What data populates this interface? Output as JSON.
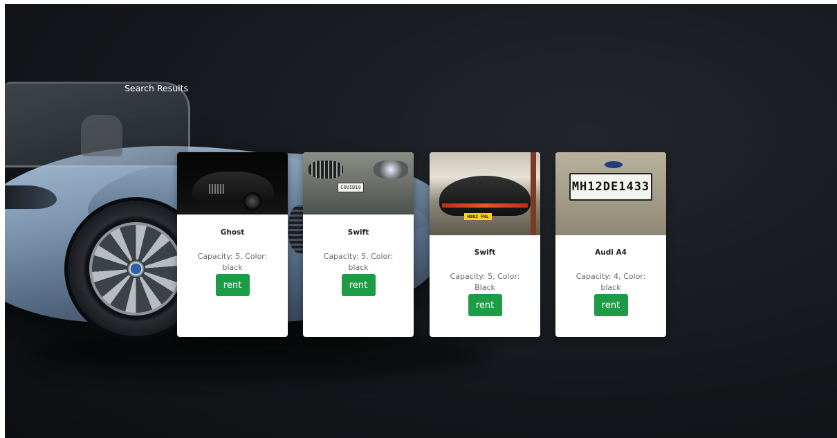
{
  "page": {
    "section_title": "Search Results"
  },
  "cars": [
    {
      "name": "Ghost",
      "info": "Capacity: 5, Color: black",
      "rent_label": "rent",
      "image_icon": "black-sedan-image"
    },
    {
      "name": "Swift",
      "info": "Capacity: 5, Color: black",
      "rent_label": "rent",
      "image_icon": "grey-car-front-image",
      "plate_text": "COVID19"
    },
    {
      "name": "Swift",
      "info": "Capacity: 5, Color: Black",
      "rent_label": "rent",
      "image_icon": "car-rear-image",
      "plate_text": "H982 FKL"
    },
    {
      "name": "Audi A4",
      "info": "Capacity: 4, Color: black",
      "rent_label": "rent",
      "image_icon": "license-plate-image",
      "plate_text": "MH12DE1433"
    }
  ],
  "colors": {
    "rent_button": "#1e9b45",
    "card_background": "#ffffff",
    "page_background": "#15181c",
    "title_text": "#ffffff"
  }
}
